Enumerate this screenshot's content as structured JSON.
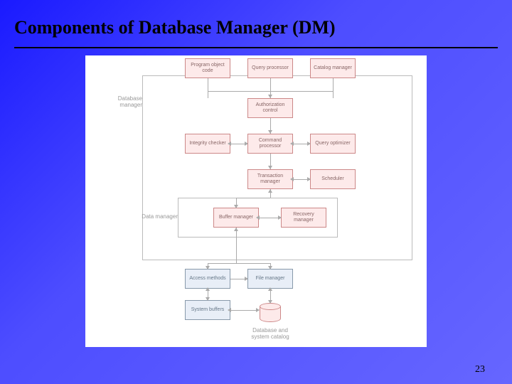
{
  "slide": {
    "title": "Components of Database Manager (DM)",
    "page_number": "23"
  },
  "labels": {
    "dm_frame": "Database manager",
    "data_frame": "Data manager",
    "cylinder": "Database and\nsystem catalog"
  },
  "boxes": {
    "program_object": "Program object code",
    "query_processor": "Query processor",
    "catalog_manager": "Catalog manager",
    "authorization": "Authorization control",
    "integrity_checker": "Integrity checker",
    "command_processor": "Command processor",
    "query_optimizer": "Query optimizer",
    "transaction_manager": "Transaction manager",
    "scheduler": "Scheduler",
    "buffer_manager": "Buffer manager",
    "recovery_manager": "Recovery manager",
    "access_methods": "Access methods",
    "file_manager": "File manager",
    "system_buffers": "System buffers"
  }
}
